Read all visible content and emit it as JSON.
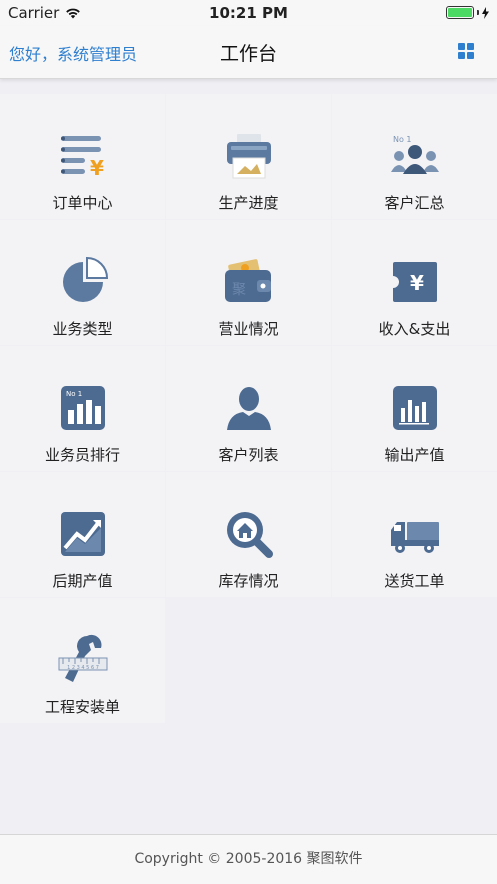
{
  "status_bar": {
    "carrier": "Carrier",
    "time": "10:21 PM",
    "battery_level": 1.0,
    "icons": [
      "wifi-icon",
      "battery-icon",
      "charging-icon"
    ]
  },
  "nav": {
    "greeting": "您好，系统管理员",
    "title": "工作台",
    "right_icon": "grid-view-icon"
  },
  "menu": [
    {
      "label": "订单中心",
      "icon": "order-list-icon"
    },
    {
      "label": "生产进度",
      "icon": "printer-icon"
    },
    {
      "label": "客户汇总",
      "icon": "customer-group-icon"
    },
    {
      "label": "业务类型",
      "icon": "pie-chart-icon"
    },
    {
      "label": "营业情况",
      "icon": "wallet-icon"
    },
    {
      "label": "收入&支出",
      "icon": "ticket-yen-icon"
    },
    {
      "label": "业务员排行",
      "icon": "ranking-chart-icon"
    },
    {
      "label": "客户列表",
      "icon": "person-icon"
    },
    {
      "label": "输出产值",
      "icon": "bar-chart-icon"
    },
    {
      "label": "后期产值",
      "icon": "trend-up-icon"
    },
    {
      "label": "库存情况",
      "icon": "house-search-icon"
    },
    {
      "label": "送货工单",
      "icon": "truck-icon"
    },
    {
      "label": "工程安装单",
      "icon": "wrench-ruler-icon"
    }
  ],
  "footer": {
    "copyright": "Copyright © 2005-2016 聚图软件"
  },
  "colors": {
    "link": "#2f7fcf",
    "icon_dark": "#3e587a",
    "icon_light": "#7b93b3",
    "background": "#efeff4"
  }
}
